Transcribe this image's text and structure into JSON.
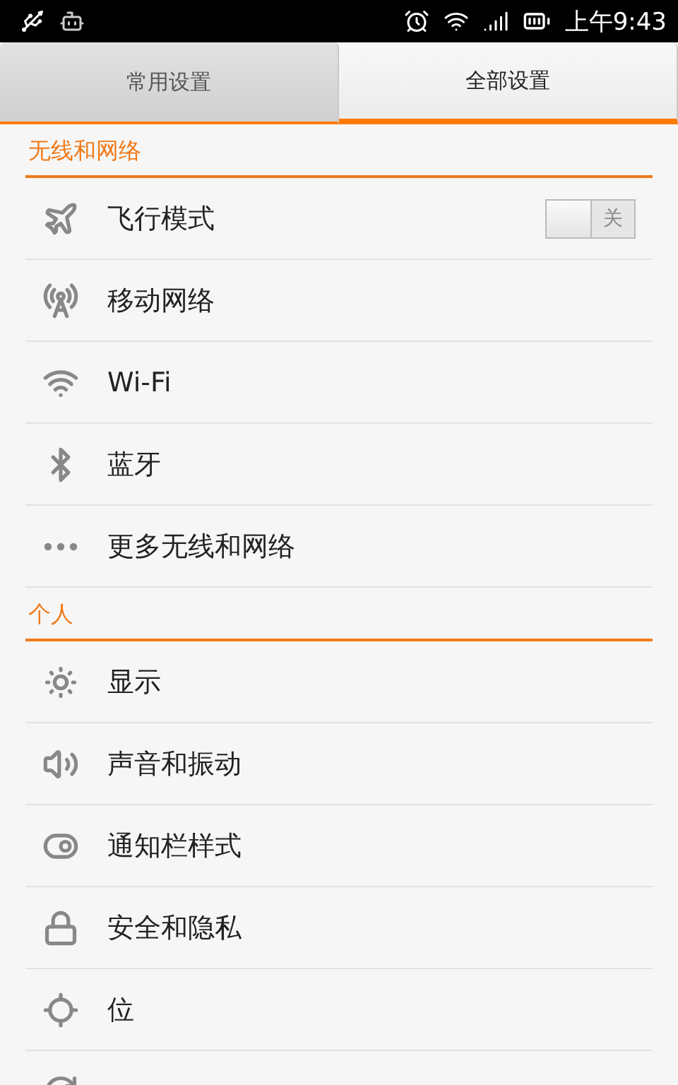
{
  "status_bar": {
    "time": "上午9:43"
  },
  "tabs": [
    {
      "label": "常用设置",
      "selected": false
    },
    {
      "label": "全部设置",
      "selected": true
    }
  ],
  "sections": [
    {
      "title": "无线和网络",
      "items": [
        {
          "label": "飞行模式",
          "kind": "toggle",
          "on": false,
          "toggle_label": "关"
        },
        {
          "label": "移动网络",
          "kind": "link"
        },
        {
          "label": "Wi-Fi",
          "kind": "link"
        },
        {
          "label": "蓝牙",
          "kind": "link"
        },
        {
          "label": "更多无线和网络",
          "kind": "link"
        }
      ]
    },
    {
      "title": "个人",
      "items": [
        {
          "label": "显示",
          "kind": "link"
        },
        {
          "label": "声音和振动",
          "kind": "link"
        },
        {
          "label": "通知栏样式",
          "kind": "link"
        },
        {
          "label": "安全和隐私",
          "kind": "link"
        },
        {
          "label": "位",
          "kind": "link"
        },
        {
          "kind": "link"
        }
      ]
    }
  ]
}
